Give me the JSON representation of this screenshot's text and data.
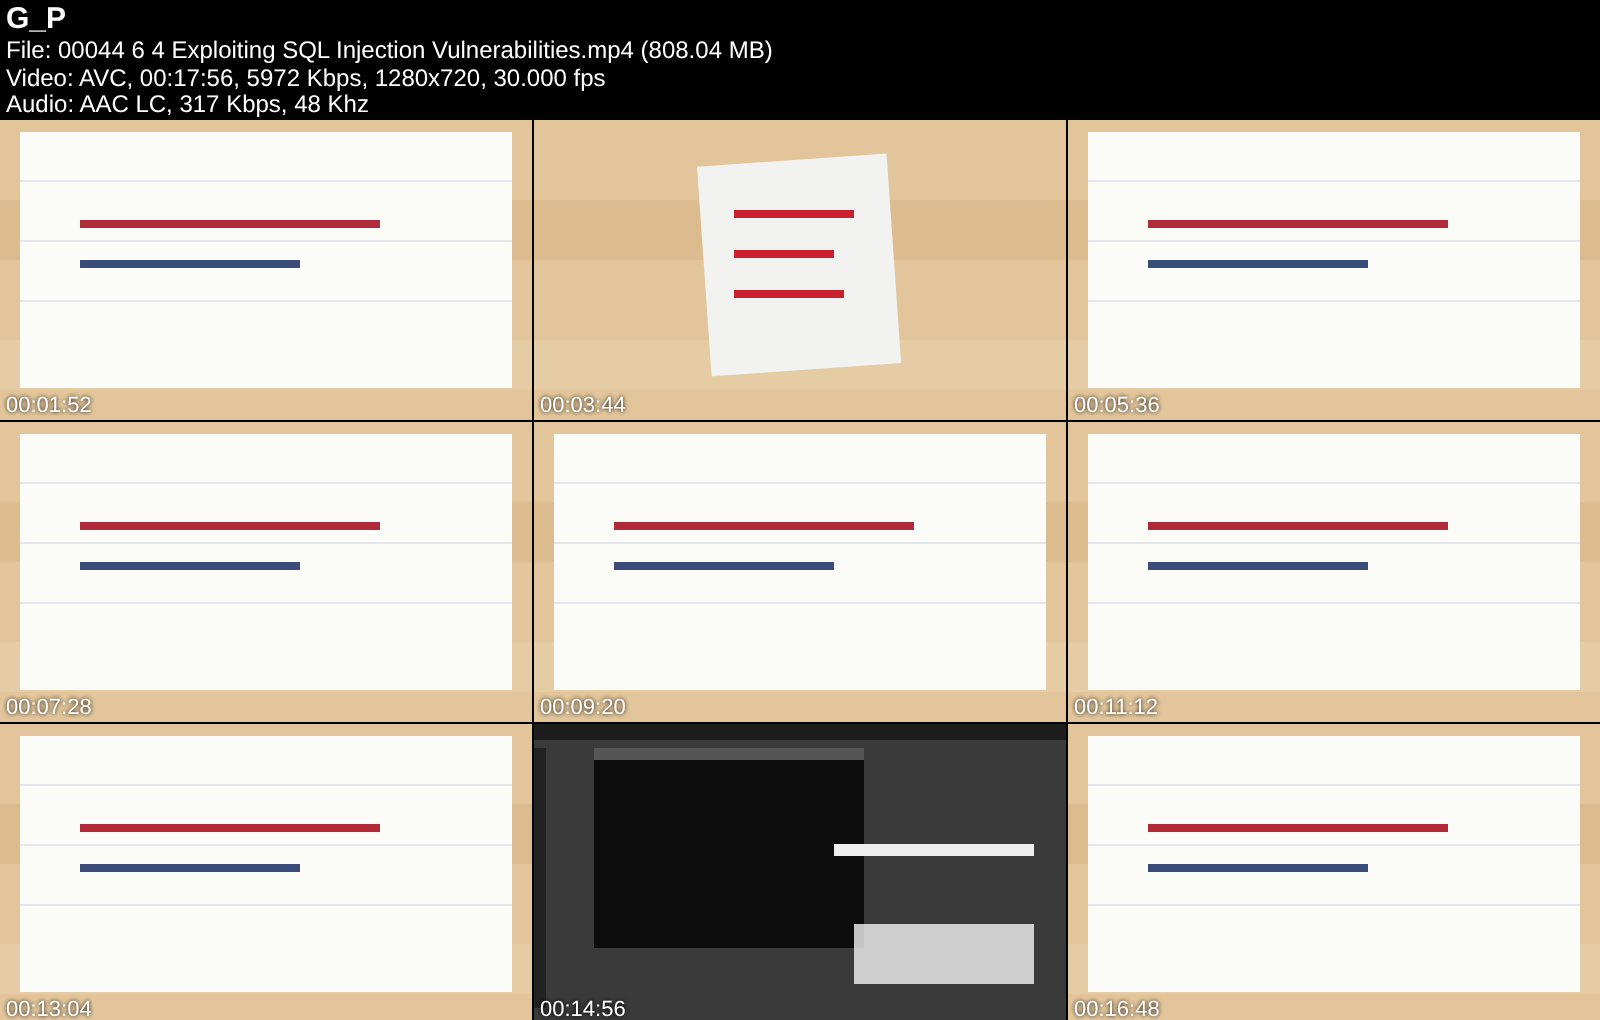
{
  "header": {
    "title": "G_P",
    "lines": [
      "File: 00044 6 4 Exploiting SQL Injection Vulnerabilities.mp4 (808.04 MB)",
      "Video: AVC, 00:17:56, 5972 Kbps, 1280x720, 30.000 fps",
      "Audio: AAC LC, 317 Kbps, 48 Khz"
    ]
  },
  "frames": [
    {
      "kind": "paper",
      "time": "00:01:52"
    },
    {
      "kind": "note",
      "time": "00:03:44"
    },
    {
      "kind": "paper",
      "time": "00:05:36"
    },
    {
      "kind": "paper",
      "time": "00:07:28"
    },
    {
      "kind": "paper",
      "time": "00:09:20"
    },
    {
      "kind": "paper",
      "time": "00:11:12"
    },
    {
      "kind": "paper",
      "time": "00:13:04"
    },
    {
      "kind": "dark",
      "time": "00:14:56"
    },
    {
      "kind": "paper",
      "time": "00:16:48"
    }
  ]
}
